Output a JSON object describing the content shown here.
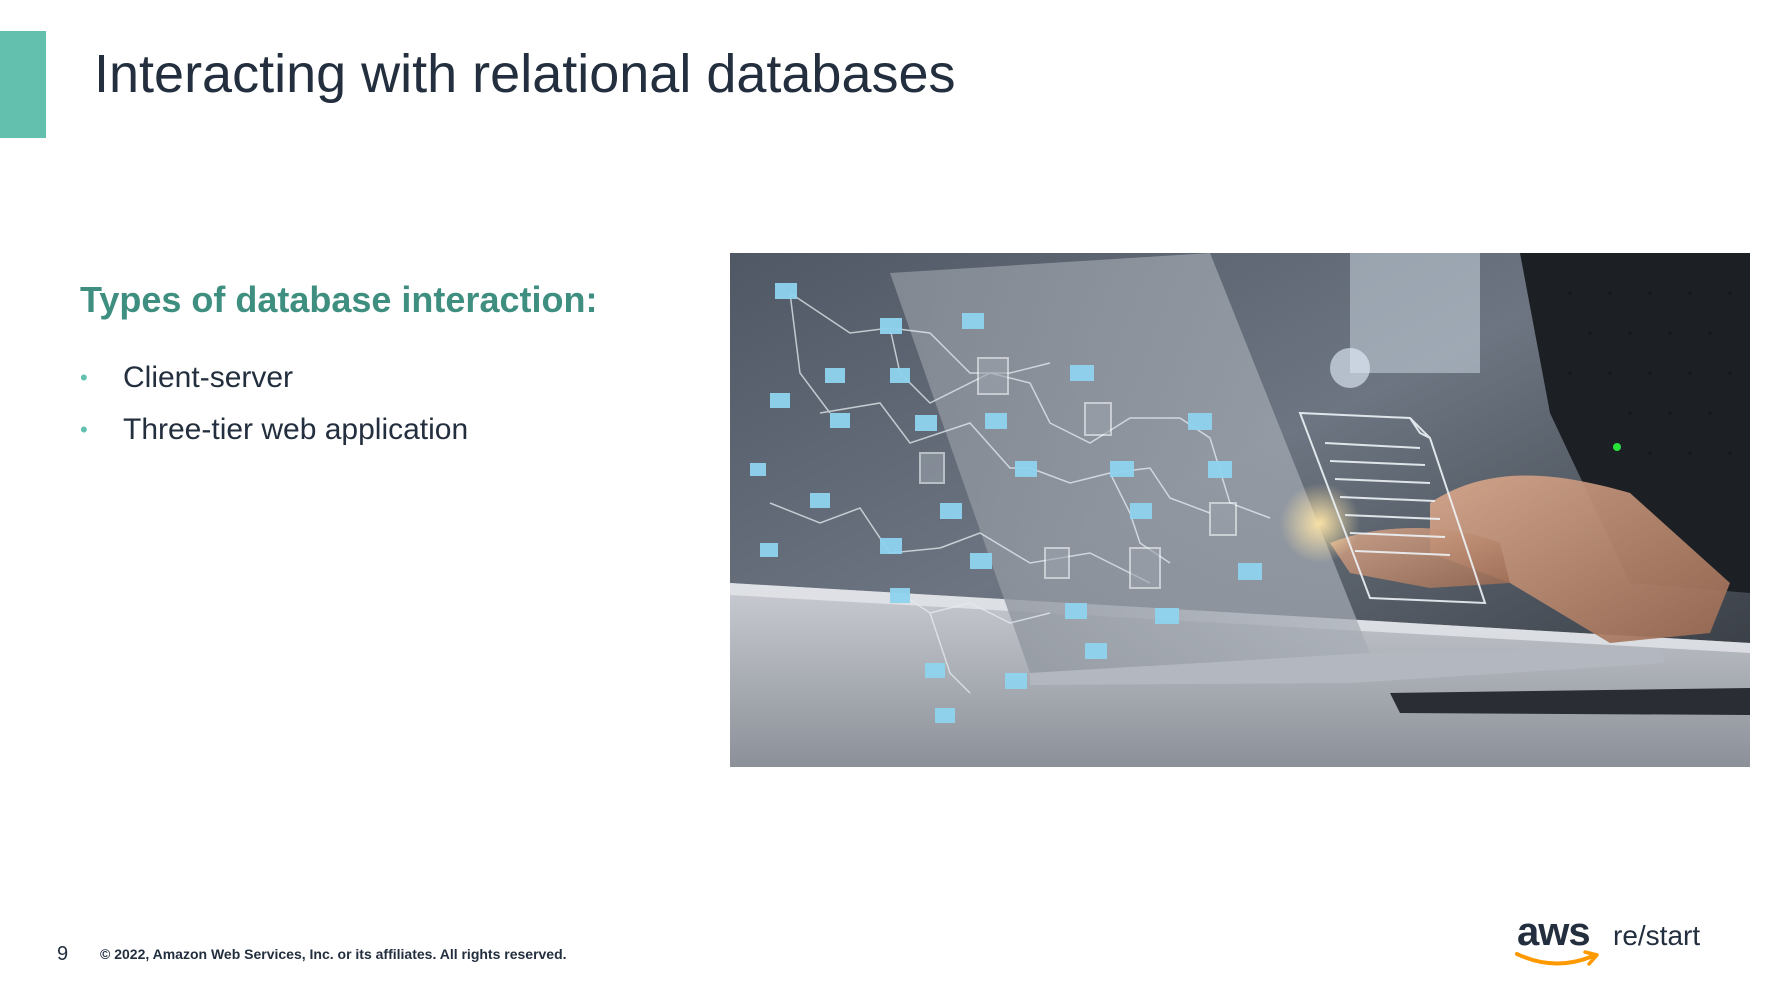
{
  "slide": {
    "title": "Interacting with relational databases",
    "subheading": "Types of database interaction:",
    "bullets": [
      {
        "text": "Client-server"
      },
      {
        "text": "Three-tier web application"
      }
    ],
    "bullet_glyph": "•",
    "hero_image": {
      "icon": "laptop-database-network-photo"
    }
  },
  "footer": {
    "page_number": "9",
    "copyright": "© 2022, Amazon Web Services, Inc. or its affiliates. All rights reserved."
  },
  "logo": {
    "aws": "aws",
    "product": "re/start"
  },
  "colors": {
    "accent": "#63bfae",
    "subheading": "#3f8f80",
    "text": "#232f3e",
    "aws_orange": "#ff9900",
    "node_blue": "#8fd3ef"
  }
}
